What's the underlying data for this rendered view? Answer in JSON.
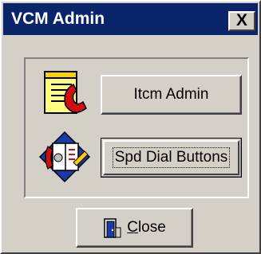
{
  "window": {
    "title": "VCM Admin",
    "close_glyph": "X"
  },
  "buttons": {
    "itcm_admin": "Itcm Admin",
    "speed_dial": "Spd Dial Buttons",
    "close_first_letter": "C",
    "close_rest": "lose"
  },
  "icons": {
    "admin": "notepad-phone-icon",
    "speed_dial": "phonebook-dial-icon",
    "close": "door-exit-icon"
  },
  "colors": {
    "titlebar": "#0a246a",
    "face": "#d4d0c8",
    "title_text": "#ffffff"
  }
}
